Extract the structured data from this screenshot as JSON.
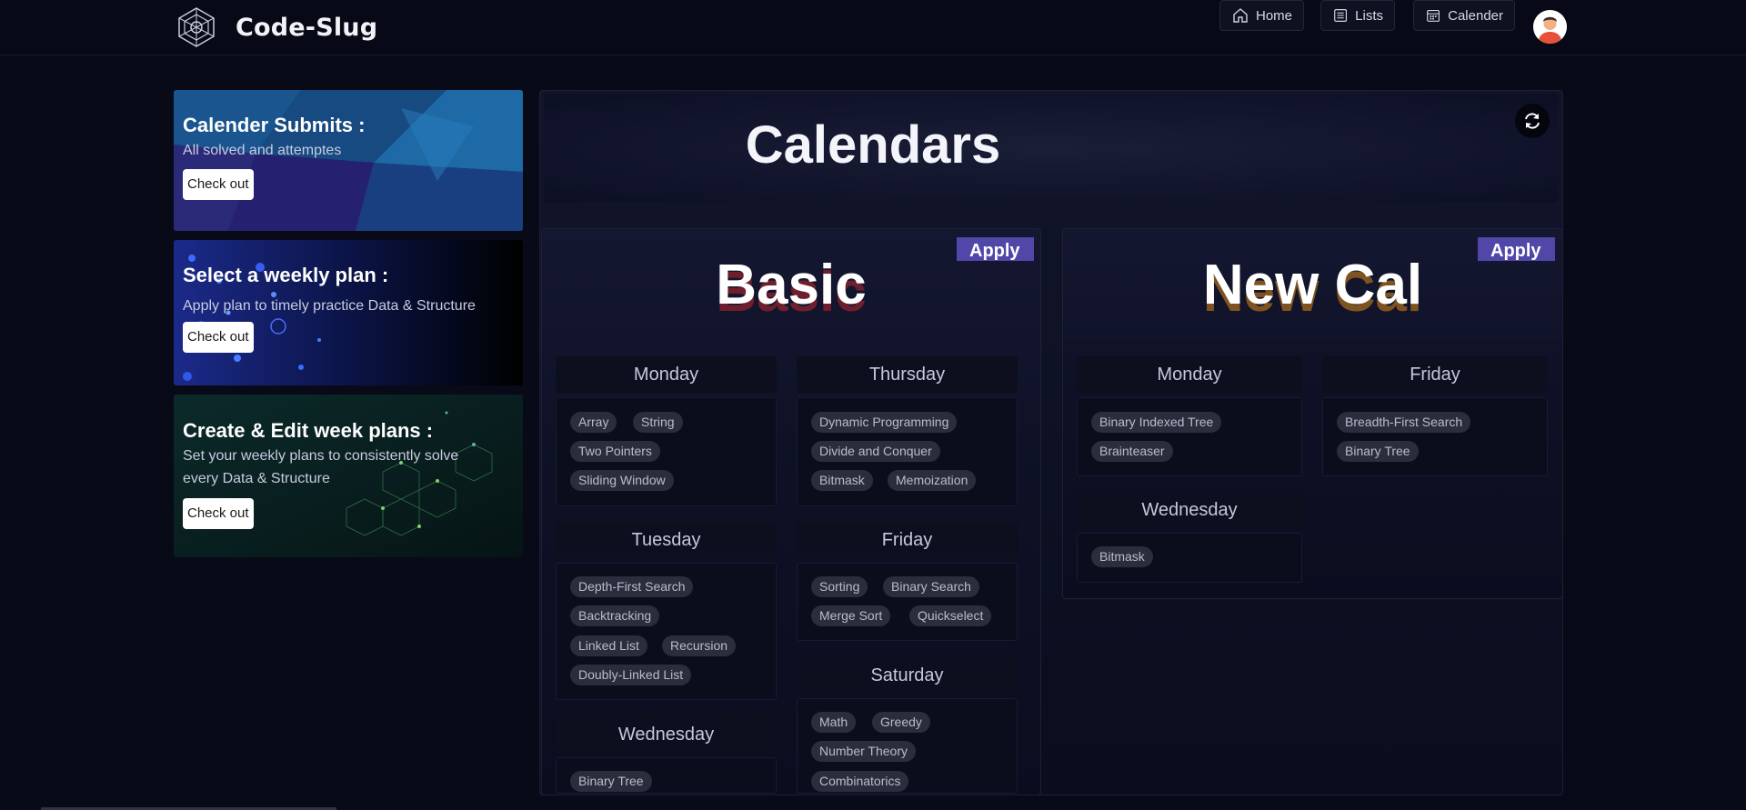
{
  "brand": {
    "name": "Code-Slug"
  },
  "nav": [
    {
      "label": "Home",
      "icon": "home-icon"
    },
    {
      "label": "Lists",
      "icon": "list-icon"
    },
    {
      "label": "Calender",
      "icon": "calendar-icon"
    }
  ],
  "promos": [
    {
      "title": "Calender Submits :",
      "text": "All solved and attemptes",
      "button": "Check out"
    },
    {
      "title": "Select a weekly plan :",
      "text": "Apply plan to timely practice Data & Structure",
      "button": "Check out"
    },
    {
      "title": "Create & Edit week plans :",
      "text": "Set your weekly plans to consistently solve every Data & Structure",
      "button": "Check out"
    }
  ],
  "page": {
    "title": "Calendars"
  },
  "calendars": [
    {
      "name": "Basic",
      "apply": "Apply",
      "shadow_color": "#7a1f2d",
      "days": [
        {
          "name": "Monday",
          "tags": [
            "Array",
            "String",
            "Two Pointers",
            "Sliding Window"
          ]
        },
        {
          "name": "Thursday",
          "tags": [
            "Dynamic Programming",
            "Divide and Conquer",
            "Bitmask",
            "Memoization"
          ]
        },
        {
          "name": "Tuesday",
          "tags": [
            "Depth-First Search",
            "Backtracking",
            "Linked List",
            "Recursion",
            "Doubly-Linked List"
          ]
        },
        {
          "name": "Friday",
          "tags": [
            "Sorting",
            "Binary Search",
            "Merge Sort",
            "Quickselect"
          ]
        },
        {
          "name": "Wednesday",
          "tags": [
            "Binary Tree"
          ]
        },
        {
          "name": "Saturday",
          "tags": [
            "Math",
            "Greedy",
            "Number Theory",
            "Combinatorics"
          ]
        }
      ]
    },
    {
      "name": "New Cal",
      "apply": "Apply",
      "shadow_color": "#8a5a1e",
      "days": [
        {
          "name": "Monday",
          "tags": [
            "Binary Indexed Tree",
            "Brainteaser"
          ]
        },
        {
          "name": "Friday",
          "tags": [
            "Breadth-First Search",
            "Binary Tree"
          ]
        },
        {
          "name": "Wednesday",
          "tags": [
            "Bitmask"
          ]
        }
      ]
    }
  ],
  "colors": {
    "accent": "#5147a8",
    "background": "#080a18"
  }
}
